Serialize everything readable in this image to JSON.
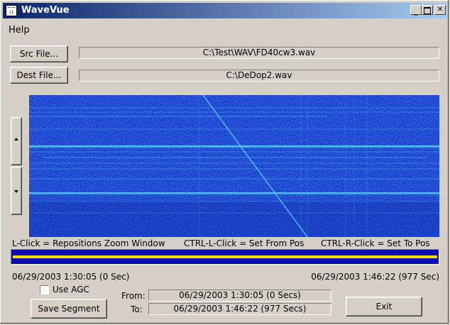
{
  "app": {
    "title": "WaveVue",
    "icon": "wave-app-icon"
  },
  "menu": {
    "help": "Help"
  },
  "source": {
    "button_label": "Src File...",
    "path": "C:\\Test\\WAV\\FD40cw3.wav"
  },
  "dest": {
    "button_label": "Dest File...",
    "path": "C:\\DeDop2.wav"
  },
  "instructions": {
    "left_click": "L-Click = Repositions Zoom Window",
    "ctrl_left": "CTRL-L-Click = Set From Pos",
    "ctrl_right": "CTRL-R-Click = Set To Pos"
  },
  "timeline": {
    "start": "06/29/2003 1:30:05 (0 Sec)",
    "end": "06/29/2003 1:46:22 (977 Sec)"
  },
  "agc": {
    "label": "Use AGC",
    "checked": false
  },
  "segment": {
    "save_label": "Save Segment",
    "from_label": "From:",
    "from_value": "06/29/2003 1:30:05 (0 Secs)",
    "to_label": "To:",
    "to_value": "06/29/2003 1:46:22 (977 Secs)"
  },
  "exit_label": "Exit",
  "colors": {
    "spectrogram_bg": "#1638c8",
    "signal": "#5ad8ff",
    "zoom_track": "#f0e000",
    "zoom_fill": "#0c0cb0",
    "title_start": "#0a246a",
    "title_end": "#a6caf0"
  }
}
